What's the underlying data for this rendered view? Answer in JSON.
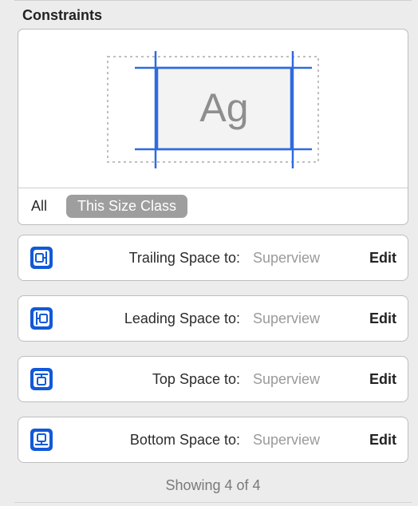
{
  "section_title": "Constraints",
  "preview_placeholder": "Ag",
  "segmented": {
    "all_label": "All",
    "current_label": "This Size Class"
  },
  "constraints": [
    {
      "icon": "trailing",
      "label": "Trailing Space to:",
      "value": "Superview",
      "edit": "Edit"
    },
    {
      "icon": "leading",
      "label": "Leading Space to:",
      "value": "Superview",
      "edit": "Edit"
    },
    {
      "icon": "top",
      "label": "Top Space to:",
      "value": "Superview",
      "edit": "Edit"
    },
    {
      "icon": "bottom",
      "label": "Bottom Space to:",
      "value": "Superview",
      "edit": "Edit"
    }
  ],
  "status": "Showing 4 of 4",
  "colors": {
    "accent": "#2e6be0",
    "icon": "#1259d8",
    "muted": "#9a9a9a"
  }
}
